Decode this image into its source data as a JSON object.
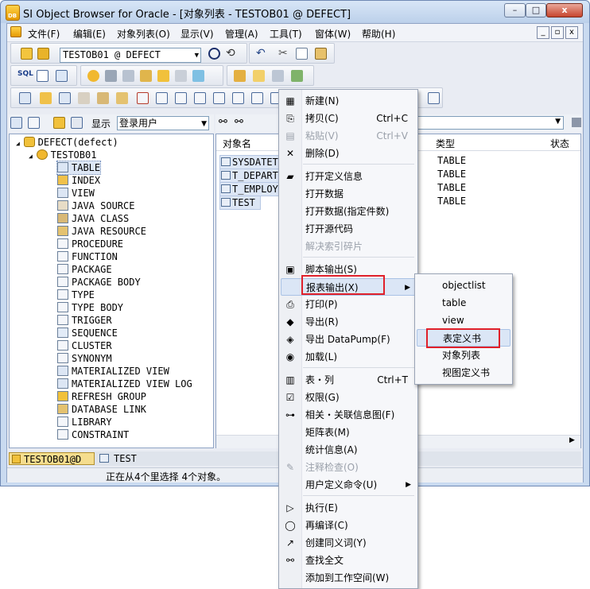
{
  "window": {
    "title": "SI Object Browser for Oracle - [对象列表 - TESTOB01 @ DEFECT]",
    "buttons": {
      "minimize": "–",
      "maximize": "□",
      "close": "x"
    }
  },
  "menubar": {
    "items": [
      "文件(F)",
      "编辑(E)",
      "对象列表(O)",
      "显示(V)",
      "管理(A)",
      "工具(T)",
      "窗体(W)",
      "帮助(H)"
    ]
  },
  "toolbar": {
    "connection_select": "TESTOB01 @ DEFECT",
    "display_label": "显示",
    "display_value": "登录用户"
  },
  "tree": {
    "root": "DEFECT(defect)",
    "user": "TESTOB01",
    "items": [
      "TABLE",
      "INDEX",
      "VIEW",
      "JAVA SOURCE",
      "JAVA CLASS",
      "JAVA RESOURCE",
      "PROCEDURE",
      "FUNCTION",
      "PACKAGE",
      "PACKAGE BODY",
      "TYPE",
      "TYPE BODY",
      "TRIGGER",
      "SEQUENCE",
      "CLUSTER",
      "SYNONYM",
      "MATERIALIZED VIEW",
      "MATERIALIZED VIEW LOG",
      "REFRESH GROUP",
      "DATABASE LINK",
      "LIBRARY",
      "CONSTRAINT"
    ],
    "selected": "TABLE"
  },
  "list": {
    "columns": [
      "对象名",
      "类型",
      "状态"
    ],
    "rows": [
      {
        "name": "SYSDATETE",
        "type": "TABLE"
      },
      {
        "name": "T_DEPART",
        "type": "TABLE"
      },
      {
        "name": "T_EMPLOY",
        "type": "TABLE"
      },
      {
        "name": "TEST",
        "type": "TABLE"
      }
    ]
  },
  "tabs": [
    "TESTOB01@D",
    "TEST"
  ],
  "status": "正在从4个里选择 4个对象。",
  "context_menu": {
    "items": [
      {
        "label": "新建(N)",
        "shortcut": "",
        "icon": "table-new-icon",
        "disabled": false
      },
      {
        "label": "拷贝(C)",
        "shortcut": "Ctrl+C",
        "icon": "copy-icon",
        "disabled": false
      },
      {
        "label": "粘贴(V)",
        "shortcut": "Ctrl+V",
        "icon": "paste-icon",
        "disabled": true
      },
      {
        "label": "删除(D)",
        "shortcut": "",
        "icon": "delete-icon",
        "disabled": false
      },
      {
        "label": "打开定义信息",
        "shortcut": "",
        "icon": "folder-open-icon",
        "disabled": false
      },
      {
        "label": "打开数据",
        "shortcut": "",
        "icon": "",
        "disabled": false
      },
      {
        "label": "打开数据(指定件数)",
        "shortcut": "",
        "icon": "",
        "disabled": false
      },
      {
        "label": "打开源代码",
        "shortcut": "",
        "icon": "",
        "disabled": false
      },
      {
        "label": "解决索引碎片",
        "shortcut": "",
        "icon": "",
        "disabled": true
      },
      {
        "label": "脚本输出(S)",
        "shortcut": "",
        "icon": "save-icon",
        "disabled": false
      },
      {
        "label": "报表输出(X)",
        "shortcut": "",
        "icon": "",
        "disabled": false
      },
      {
        "label": "打印(P)",
        "shortcut": "",
        "icon": "print-icon",
        "disabled": false
      },
      {
        "label": "导出(R)",
        "shortcut": "",
        "icon": "export-icon",
        "disabled": false
      },
      {
        "label": "导出 DataPump(F)",
        "shortcut": "",
        "icon": "datapump-icon",
        "disabled": false
      },
      {
        "label": "加载(L)",
        "shortcut": "",
        "icon": "load-icon",
        "disabled": false
      },
      {
        "label": "表・列",
        "shortcut": "Ctrl+T",
        "icon": "table-column-icon",
        "disabled": false
      },
      {
        "label": "权限(G)",
        "shortcut": "",
        "icon": "checkbox-icon",
        "disabled": false
      },
      {
        "label": "相关・关联信息图(F)",
        "shortcut": "",
        "icon": "relation-icon",
        "disabled": false
      },
      {
        "label": "矩阵表(M)",
        "shortcut": "",
        "icon": "",
        "disabled": false
      },
      {
        "label": "统计信息(A)",
        "shortcut": "",
        "icon": "",
        "disabled": false
      },
      {
        "label": "注释检查(O)",
        "shortcut": "",
        "icon": "pen-icon",
        "disabled": true
      },
      {
        "label": "用户定义命令(U)",
        "shortcut": "",
        "icon": "",
        "disabled": false
      },
      {
        "label": "执行(E)",
        "shortcut": "",
        "icon": "play-icon",
        "disabled": false
      },
      {
        "label": "再编译(C)",
        "shortcut": "",
        "icon": "recompile-icon",
        "disabled": false
      },
      {
        "label": "创建同义词(Y)",
        "shortcut": "",
        "icon": "synonym-icon",
        "disabled": false
      },
      {
        "label": "查找全文",
        "shortcut": "",
        "icon": "binoculars-icon",
        "disabled": false
      },
      {
        "label": "添加到工作空间(W)",
        "shortcut": "",
        "icon": "",
        "disabled": false
      }
    ]
  },
  "submenu": {
    "items": [
      "objectlist",
      "table",
      "view",
      "表定义书",
      "对象列表",
      "视图定义书"
    ]
  }
}
